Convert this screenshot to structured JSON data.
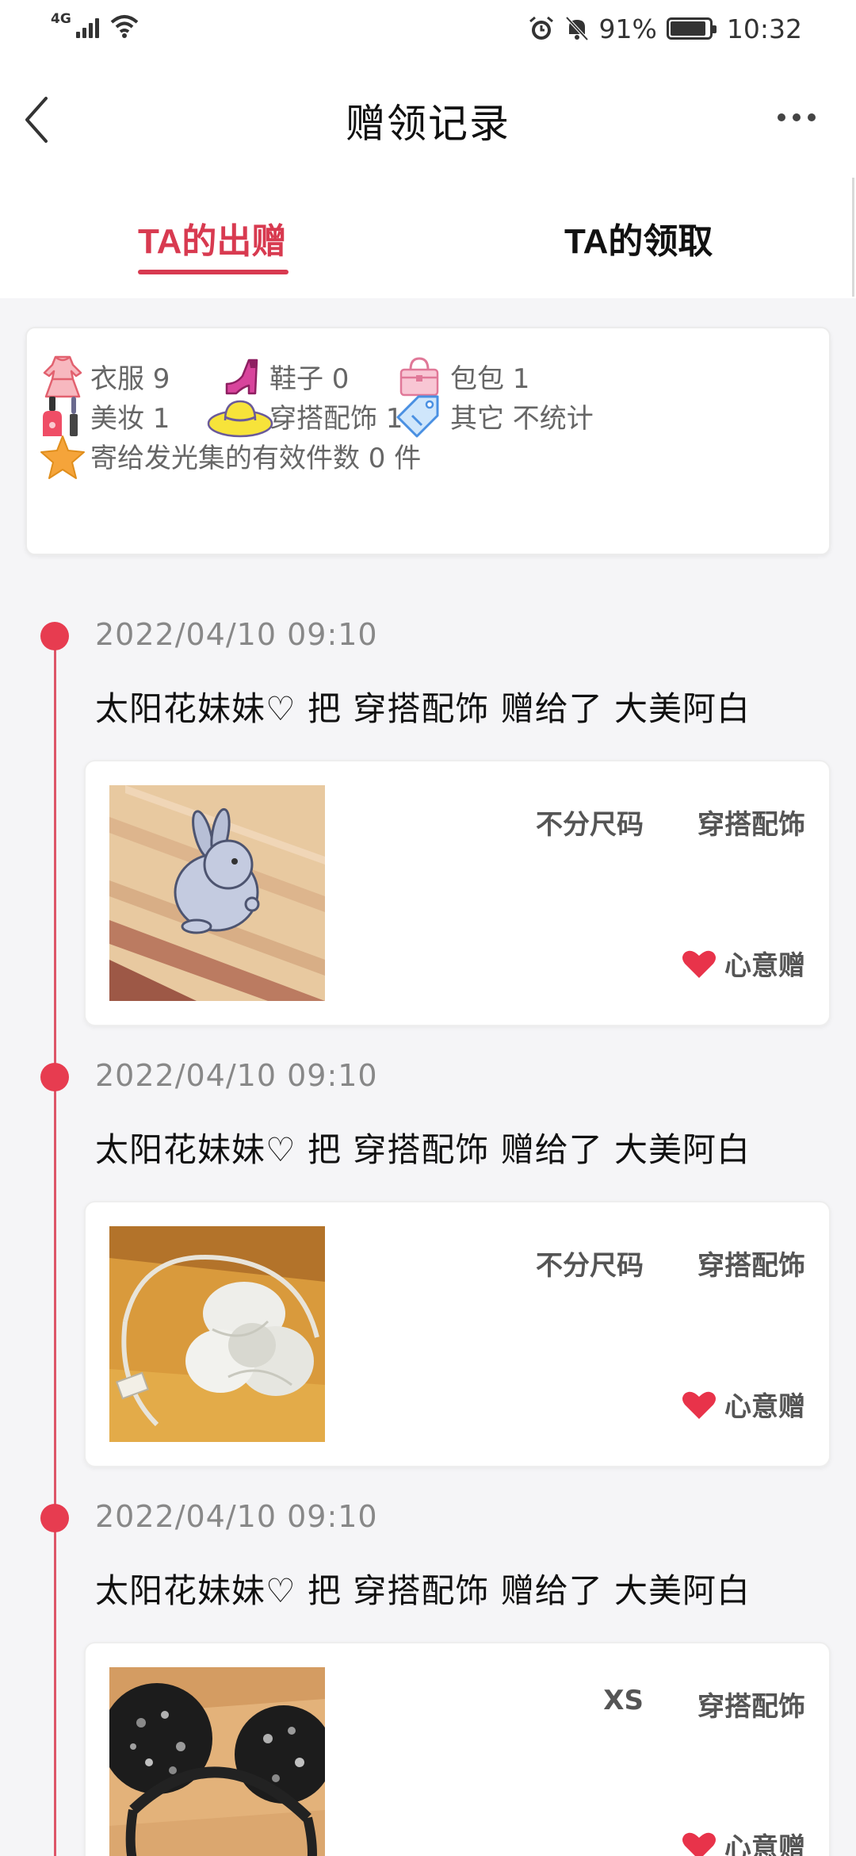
{
  "status_bar": {
    "network": "4G",
    "battery_percent": "91%",
    "battery_level": 0.91,
    "time": "10:32"
  },
  "header": {
    "title": "赠领记录",
    "back_icon": "chevron-left-icon",
    "more_icon": "more-horizontal-icon"
  },
  "tabs": [
    {
      "label": "TA的出赠",
      "active": true
    },
    {
      "label": "TA的领取",
      "active": false
    }
  ],
  "colors": {
    "accent": "#d83a50",
    "timeline_dot": "#e73c50",
    "heart": "#e8334a"
  },
  "summary": {
    "stats": [
      {
        "icon": "dress-icon",
        "label": "衣服 9"
      },
      {
        "icon": "high-heel-icon",
        "label": "鞋子 0"
      },
      {
        "icon": "handbag-icon",
        "label": "包包 1"
      },
      {
        "icon": "nail-polish-icon",
        "label": "美妆 1"
      },
      {
        "icon": "sun-hat-icon",
        "label": "穿搭配饰 14"
      },
      {
        "icon": "price-tag-icon",
        "label": "其它 不统计"
      }
    ],
    "effective": {
      "icon": "star-icon",
      "label": "寄给发光集的有效件数 0 件"
    }
  },
  "records": [
    {
      "date": "2022/04/10 09:10",
      "description": "太阳花妹妹♡ 把 穿搭配饰 赠给了 大美阿白",
      "size": "不分尺码",
      "category": "穿搭配饰",
      "tag": "心意赠",
      "photo": "rabbit-pin-photo"
    },
    {
      "date": "2022/04/10 09:10",
      "description": "太阳花妹妹♡ 把 穿搭配饰 赠给了 大美阿白",
      "size": "不分尺码",
      "category": "穿搭配饰",
      "tag": "心意赠",
      "photo": "bow-headband-photo"
    },
    {
      "date": "2022/04/10 09:10",
      "description": "太阳花妹妹♡ 把 穿搭配饰 赠给了 大美阿白",
      "size": "XS",
      "category": "穿搭配饰",
      "tag": "心意赠",
      "photo": "mouse-ears-headband-photo"
    }
  ]
}
